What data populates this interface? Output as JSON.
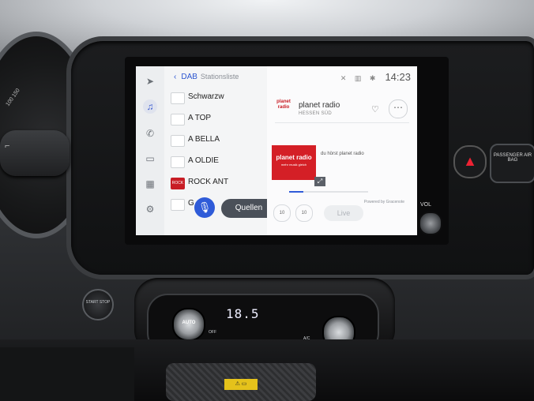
{
  "screen": {
    "breadcrumb": {
      "source": "DAB",
      "section": "Stationsliste"
    },
    "status_time": "14:23",
    "stations": [
      {
        "name": "Schwarzw",
        "logo": ""
      },
      {
        "name": "A TOP",
        "logo": ""
      },
      {
        "name": "A BELLA",
        "logo": ""
      },
      {
        "name": "A OLDIE",
        "logo": ""
      },
      {
        "name": "ROCK ANT",
        "logo": "ROCK"
      },
      {
        "name": "G",
        "logo": ""
      }
    ],
    "sources_button": "Quellen",
    "now_playing": {
      "station_logo_text": "planet radio",
      "station_name": "planet radio",
      "station_region": "HESSEN SÜD",
      "cover_title": "planet radio",
      "cover_slogan": "mehr musik gleich",
      "info_text": "du hörst planet radio",
      "powered_by": "Powered by Gracenote",
      "skip_back": "10",
      "skip_forward": "10",
      "live_label": "Live",
      "progress": 0.18
    }
  },
  "dashboard": {
    "volume_label": "VOL",
    "airbag_label": "PASSENGER AIR BAG",
    "temperature": "18.5",
    "auto_label": "AUTO",
    "ac_label": "A/C",
    "off_label": "OFF",
    "start_stop_label": "START STOP",
    "speed_marks": "100 150"
  }
}
